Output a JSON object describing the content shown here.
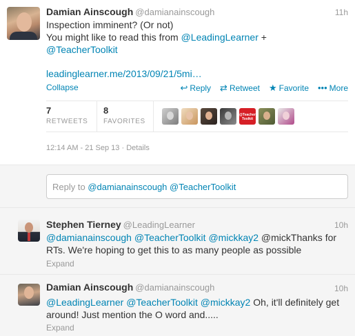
{
  "main_tweet": {
    "name": "Damian Ainscough",
    "handle": "@damianainscough",
    "time": "11h",
    "text_line1": "Inspection imminent? (Or not)",
    "text_line2_prefix": "You might like to read this from ",
    "mention1": "@LeadingLearner",
    "plus": " +",
    "mention2": "@TeacherToolkit",
    "link": "leadinglearner.me/2013/09/21/5mi…",
    "collapse": "Collapse",
    "actions": {
      "reply": "Reply",
      "retweet": "Retweet",
      "favorite": "Favorite",
      "more": "More"
    },
    "icons": {
      "reply": "reply-arrow-icon",
      "retweet": "retweet-icon",
      "favorite": "star-icon",
      "more": "ellipsis-icon"
    },
    "stats": {
      "retweets_count": "7",
      "retweets_label": "RETWEETS",
      "favorites_count": "8",
      "favorites_label": "FAVORITES",
      "favoriter_avatar_count": 7,
      "teacher_toolkit_avatar_text": "@Teacher Toolkit"
    },
    "timestamp": "12:14 AM - 21 Sep 13",
    "separator": " · ",
    "details": "Details"
  },
  "reply_box": {
    "prefix": "Reply to ",
    "mention1": "@damianainscough",
    "mention2": "@TeacherToolkit"
  },
  "replies": [
    {
      "name": "Stephen Tierney",
      "handle": "@LeadingLearner",
      "time": "10h",
      "mentions": [
        "@damianainscough",
        "@TeacherToolkit",
        "@mickkay2"
      ],
      "text_after_mentions": " @mickThanks for",
      "text_line2": "RTs. We're hoping to get this to as many people as possible",
      "expand": "Expand"
    },
    {
      "name": "Damian Ainscough",
      "handle": "@damianainscough",
      "time": "10h",
      "mentions": [
        "@LeadingLearner",
        "@TeacherToolkit",
        "@mickkay2"
      ],
      "text_after_mentions": " Oh, it'll definitely get",
      "text_line2": "around! Just mention the O word and.....",
      "expand": "Expand"
    }
  ],
  "colors": {
    "link": "#0084b4",
    "muted": "#999999",
    "text": "#333333",
    "reply_background": "#f5f5f5"
  }
}
